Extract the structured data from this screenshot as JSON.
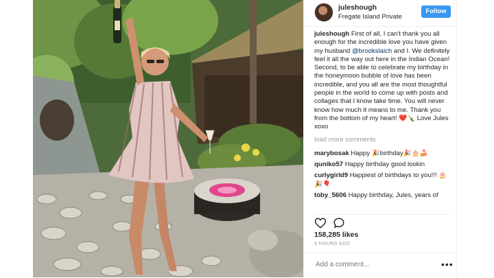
{
  "post": {
    "username": "juleshough",
    "location": "Fregate Island Private",
    "follow_label": "Follow",
    "caption_user": "juleshough",
    "caption_part1": " First of all, I can't thank you all enough for the incredible love you have given my husband ",
    "caption_mention": "@brookslaich",
    "caption_part2": " and I. We definitely feel it all the way out here in the Indian Ocean! Second, to be able to celebrate my birthday in the honeymoon bubble of love has been incredible, and you all are the most thoughtful people in the world to come up with posts and collages that I know take time. You will never know how much it means to me. Thank you from the bottom of my heart! ❤️🍾 Love Jules xoxo",
    "load_more": "load more comments",
    "comments": [
      {
        "user": "marybosak",
        "text": " Happy 🎉birthday🎉🎂🍰"
      },
      {
        "user": "quniko57",
        "text": " Happy birthday good lookin"
      },
      {
        "user": "curlygirld9",
        "text": " Happiest of birthdays to you!!! 🎂🎉🎈"
      },
      {
        "user": "toby_5606",
        "text": " Happy birthday, Jules, years of"
      }
    ],
    "likes": "158,285 likes",
    "time_ago": "9 HOURS AGO",
    "add_comment_placeholder": "Add a comment...",
    "more_label": "•••",
    "icons": [
      "heart-icon",
      "comment-icon",
      "more-options-icon"
    ]
  }
}
